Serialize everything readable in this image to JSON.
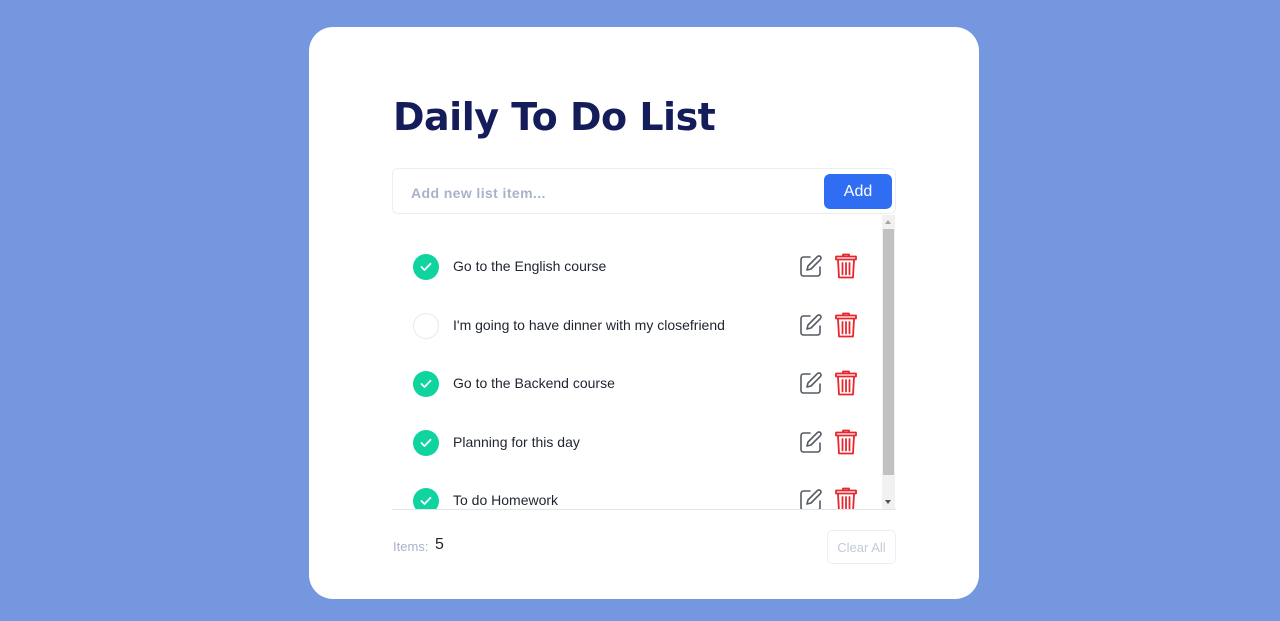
{
  "app": {
    "title": "Daily To Do List"
  },
  "input": {
    "placeholder": "Add new list item...",
    "value": "",
    "add_label": "Add"
  },
  "todos": [
    {
      "text": "Go to the English course",
      "done": true
    },
    {
      "text": "I'm going to have dinner with my closefriend",
      "done": false
    },
    {
      "text": "Go to the Backend course",
      "done": true
    },
    {
      "text": "Planning for this day",
      "done": true
    },
    {
      "text": "To do Homework",
      "done": true
    }
  ],
  "icons": {
    "check": "check-icon",
    "edit": "edit-icon",
    "delete": "trash-icon"
  },
  "footer": {
    "items_label": "Items:",
    "items_count": "5",
    "clear_label": "Clear All"
  },
  "colors": {
    "background": "#7597e0",
    "title": "#151c5a",
    "accent": "#2f6ef3",
    "done": "#10d49f",
    "delete": "#e8262c"
  }
}
